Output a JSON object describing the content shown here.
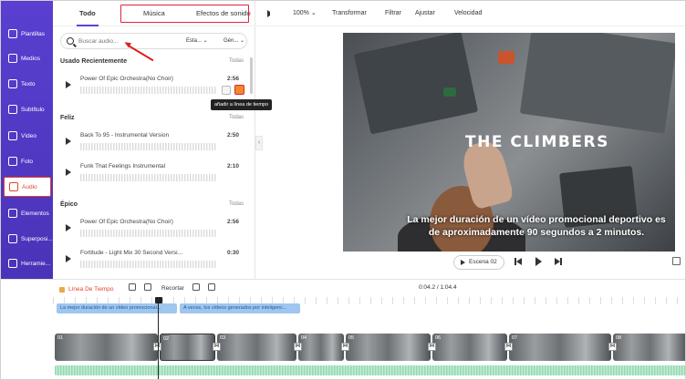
{
  "nav": {
    "items": [
      {
        "label": "Plantillas",
        "icon": "template-icon"
      },
      {
        "label": "Medios",
        "icon": "media-icon"
      },
      {
        "label": "Texto",
        "icon": "text-icon"
      },
      {
        "label": "Subtítulo",
        "icon": "subtitle-icon"
      },
      {
        "label": "Vídeo",
        "icon": "video-icon"
      },
      {
        "label": "Foto",
        "icon": "photo-icon"
      },
      {
        "label": "Audio",
        "icon": "audio-icon",
        "active": true
      },
      {
        "label": "Elementos",
        "icon": "elements-icon"
      },
      {
        "label": "Superposi...",
        "icon": "overlay-icon"
      },
      {
        "label": "Herramie...",
        "icon": "tools-icon"
      }
    ]
  },
  "panel": {
    "tabs": [
      "Todo",
      "Música",
      "Efectos de sonido"
    ],
    "search_placeholder": "Buscar audio...",
    "filter1": "Esta...",
    "filter2": "Gén...",
    "sections": [
      {
        "title": "Usado Recientemente",
        "all": "Todas",
        "tracks": [
          {
            "name": "Power Of Epic Orchestra(No Choir)",
            "duration": "2:56"
          }
        ]
      },
      {
        "title": "Feliz",
        "all": "Todas",
        "tracks": [
          {
            "name": "Back To 95 - Instrumental Version",
            "duration": "2:50"
          },
          {
            "name": "Funk That Feelings Instrumental",
            "duration": "2:10"
          }
        ]
      },
      {
        "title": "Épico",
        "all": "Todas",
        "tracks": [
          {
            "name": "Power Of Epic Orchestra(No Choir)",
            "duration": "2:56"
          },
          {
            "name": "Fortitude - Light Mix 30 Second Versi...",
            "duration": "0:30"
          }
        ]
      }
    ],
    "tooltip": "añadir a línea de tiempo"
  },
  "toolbar": {
    "zoom": "100%",
    "items": [
      "Transformar",
      "Filtrar",
      "Ajustar",
      "Velocidad"
    ]
  },
  "preview": {
    "title": "THE CLIMBERS",
    "caption": "La mejor duración de un vídeo promocional deportivo es de aproximadamente 90 segundos a 2 minutos."
  },
  "player": {
    "scene": "Escena 02"
  },
  "timeline": {
    "label": "Línea De Tiempo",
    "crop": "Recortar",
    "time": "0:04.2 / 1:04.4",
    "captions": [
      "La mejor duración de un vídeo promocional...",
      "A veces, los vídeos generados por inteligenc..."
    ],
    "clips": [
      "01",
      "02",
      "03",
      "04",
      "05",
      "06",
      "07",
      "08"
    ]
  }
}
